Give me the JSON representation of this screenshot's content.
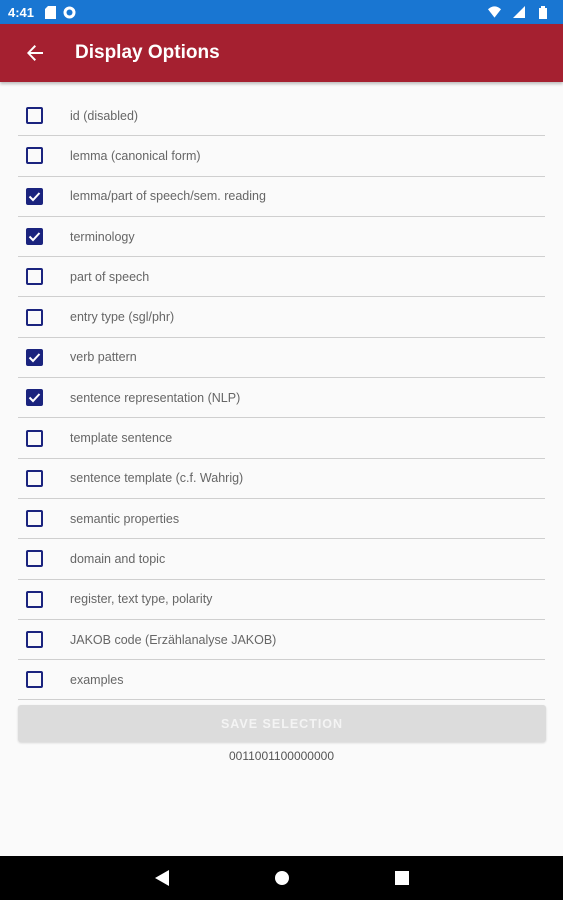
{
  "status_bar": {
    "time": "4:41"
  },
  "app_bar": {
    "title": "Display Options",
    "back_icon": "arrow-back-icon"
  },
  "options": [
    {
      "label": "id (disabled)",
      "checked": false
    },
    {
      "label": "lemma (canonical form)",
      "checked": false
    },
    {
      "label": "lemma/part of speech/sem. reading",
      "checked": true
    },
    {
      "label": "terminology",
      "checked": true
    },
    {
      "label": "part of speech",
      "checked": false
    },
    {
      "label": "entry type (sgl/phr)",
      "checked": false
    },
    {
      "label": "verb pattern",
      "checked": true
    },
    {
      "label": "sentence representation (NLP)",
      "checked": true
    },
    {
      "label": "template sentence",
      "checked": false
    },
    {
      "label": "sentence template (c.f. Wahrig)",
      "checked": false
    },
    {
      "label": "semantic properties",
      "checked": false
    },
    {
      "label": "domain and topic",
      "checked": false
    },
    {
      "label": "register, text type, polarity",
      "checked": false
    },
    {
      "label": "JAKOB code (Erzählanalyse JAKOB)",
      "checked": false
    },
    {
      "label": "examples",
      "checked": false
    }
  ],
  "save_button": {
    "label": "SAVE SELECTION"
  },
  "selection_code": "0011001100000000",
  "colors": {
    "app_bar": "#a52030",
    "status_bar": "#1976d2",
    "checkbox": "#1a237e"
  }
}
